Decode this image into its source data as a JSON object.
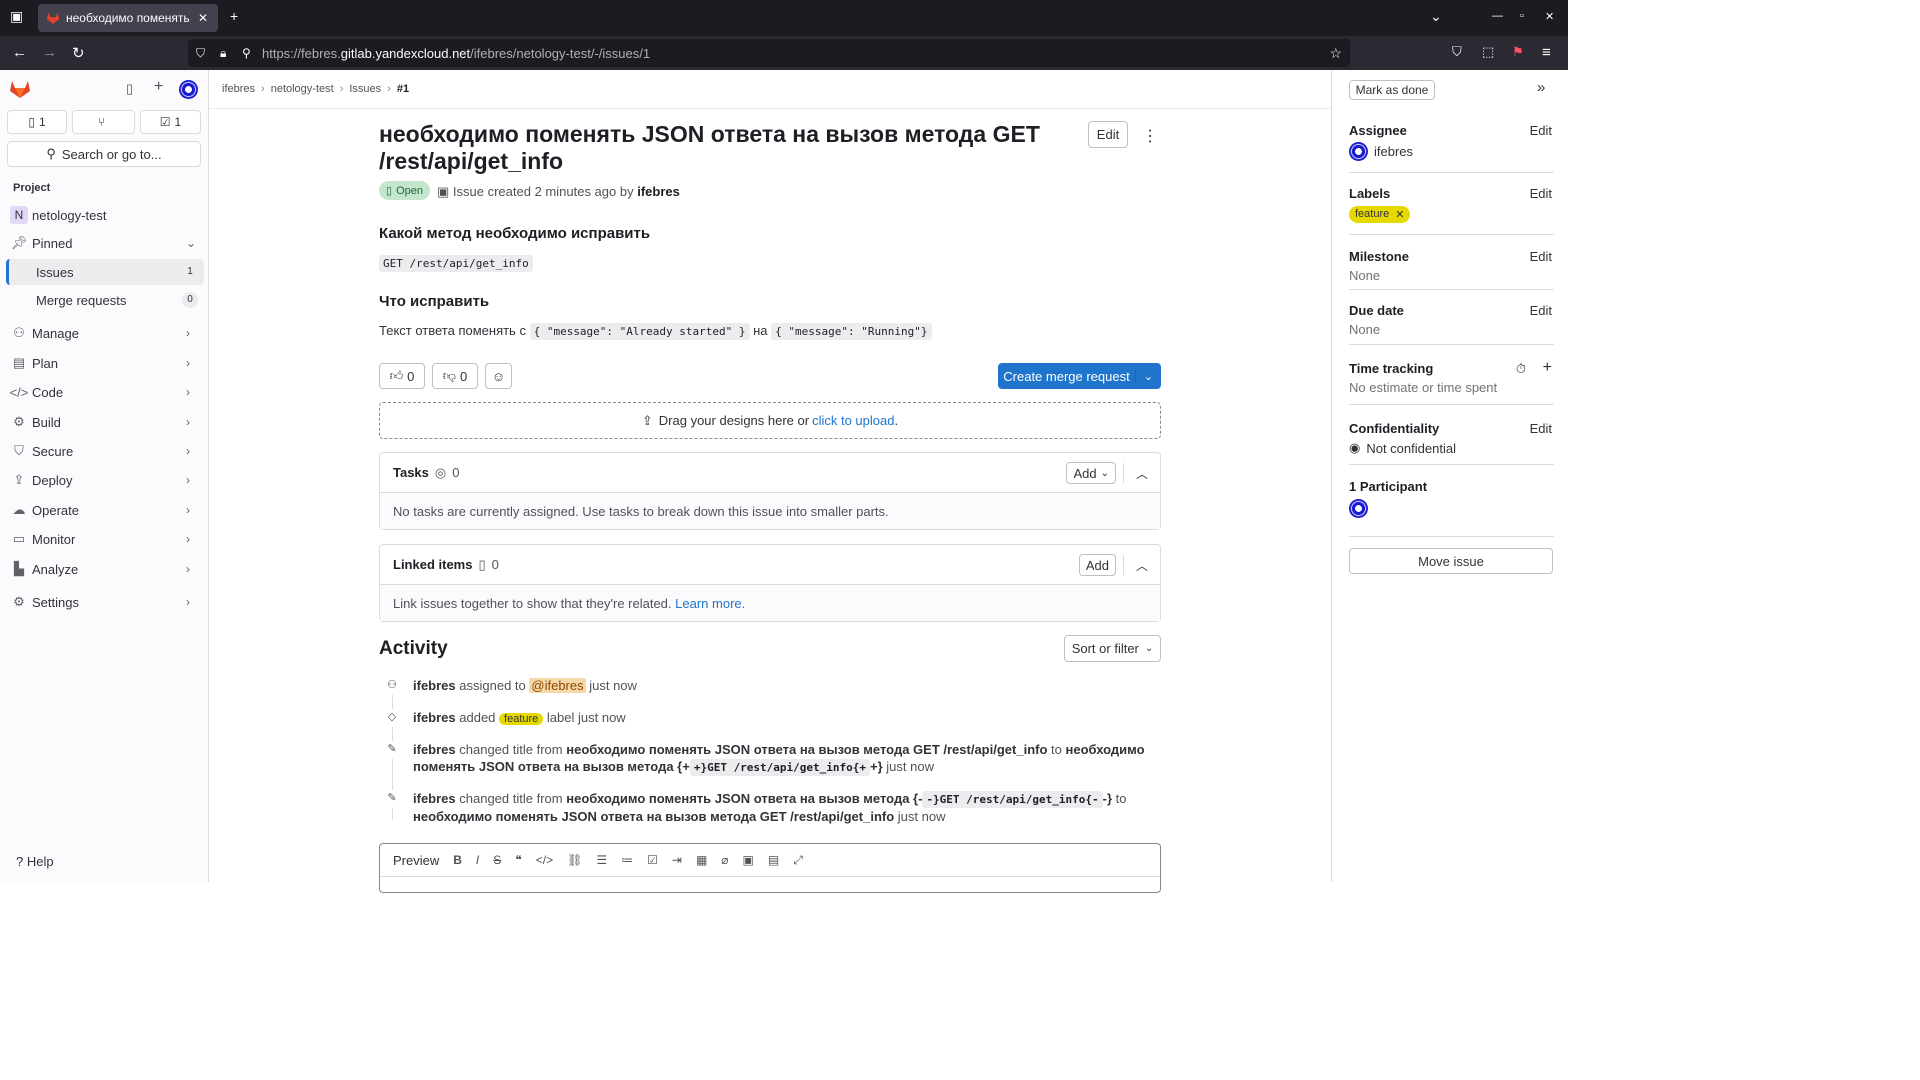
{
  "browser": {
    "tab_title": "необходимо поменять",
    "url_prefix": "https://febres.",
    "url_host": "gitlab.yandexcloud.net",
    "url_path": "/ifebres/netology-test/-/issues/1"
  },
  "sidebar": {
    "counts": {
      "issues": "1",
      "merge_requests": "",
      "todos": "1"
    },
    "search_label": "Search or go to...",
    "section_label": "Project",
    "project_initial": "N",
    "project_name": "netology-test",
    "pinned_label": "Pinned",
    "issues_label": "Issues",
    "issues_count": "1",
    "mr_label": "Merge requests",
    "mr_count": "0",
    "nav": [
      "Manage",
      "Plan",
      "Code",
      "Build",
      "Secure",
      "Deploy",
      "Operate",
      "Monitor",
      "Analyze"
    ],
    "settings_label": "Settings",
    "help_label": "Help"
  },
  "breadcrumb": [
    "ifebres",
    "netology-test",
    "Issues",
    "#1"
  ],
  "issue": {
    "title": "необходимо поменять JSON ответа на вызов метода GET /rest/api/get_info",
    "edit_label": "Edit",
    "status": "Open",
    "created_prefix": "Issue created 2 minutes ago by",
    "author": "ifebres",
    "h1": "Какой метод необходимо исправить",
    "code1": "GET /rest/api/get_info",
    "h2": "Что исправить",
    "desc_prefix": "Текст ответа поменять с",
    "code2": "{ \"message\": \"Already started\" }",
    "desc_mid": "на",
    "code3": "{ \"message\": \"Running\"}"
  },
  "reactions": {
    "thumbs_up": "0",
    "thumbs_down": "0"
  },
  "create_mr_label": "Create merge request",
  "dropzone": {
    "text": "Drag your designs here or",
    "link": "click to upload",
    "tail": "."
  },
  "tasks": {
    "title": "Tasks",
    "count": "0",
    "add_label": "Add",
    "empty": "No tasks are currently assigned. Use tasks to break down this issue into smaller parts."
  },
  "linked": {
    "title": "Linked items",
    "count": "0",
    "add_label": "Add",
    "empty": "Link issues together to show that they're related.",
    "learn_more": "Learn more."
  },
  "activity": {
    "title": "Activity",
    "sort_label": "Sort or filter",
    "items": [
      {
        "user": "ifebres",
        "a": "assigned to",
        "mention": "@ifebres",
        "b": "just now"
      },
      {
        "user": "ifebres",
        "a": "added",
        "label": "feature",
        "b": "label just now"
      },
      {
        "user": "ifebres",
        "a": "changed title from",
        "from": "необходимо поменять JSON ответа на вызов метода GET /rest/api/get_info",
        "to_word": "to",
        "to_a": "необходимо поменять JSON ответа на вызов метода {+",
        "to_code": "+}GET /rest/api/get_info{+",
        "to_b": "+}",
        "time": "just now"
      },
      {
        "user": "ifebres",
        "a": "changed title from",
        "from": "необходимо поменять JSON ответа на вызов метода {-",
        "from_code": "-}GET /rest/api/get_info{-",
        "from_b": "-}",
        "to_word": "to",
        "to": "необходимо поменять JSON ответа на вызов метода GET /rest/api/get_info",
        "time": "just now"
      }
    ]
  },
  "editor": {
    "preview_label": "Preview"
  },
  "right": {
    "mark_done": "Mark as done",
    "assignee_h": "Assignee",
    "assignee": "ifebres",
    "labels_h": "Labels",
    "label": "feature",
    "milestone_h": "Milestone",
    "milestone": "None",
    "due_h": "Due date",
    "due": "None",
    "time_h": "Time tracking",
    "time": "No estimate or time spent",
    "conf_h": "Confidentiality",
    "conf": "Not confidential",
    "participants_h": "1 Participant",
    "edit_label": "Edit",
    "move_label": "Move issue"
  },
  "colors": {
    "accent": "#1f75cb",
    "open_badge": "#c3e6cd",
    "label": "#e6d900"
  }
}
